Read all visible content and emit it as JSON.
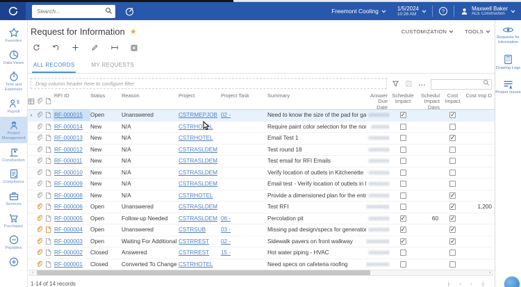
{
  "top_bar": {
    "search_placeholder": "Search...",
    "company": "Freemont Cooling",
    "date": "1/5/2024",
    "time": "10:26 AM",
    "user_name": "Maxwell Baker",
    "user_org": "ACE Construction"
  },
  "sidebar": {
    "items": [
      {
        "label": "Favorites",
        "icon": "star",
        "selected": false
      },
      {
        "label": "Data Views",
        "icon": "pie",
        "selected": false
      },
      {
        "label": "Time and Expenses",
        "icon": "stopwatch",
        "selected": false
      },
      {
        "label": "Payroll",
        "icon": "payroll",
        "selected": false
      },
      {
        "label": "Project Management",
        "icon": "worker",
        "selected": true
      },
      {
        "label": "Construction",
        "icon": "crane",
        "selected": false
      },
      {
        "label": "Compliance",
        "icon": "clipboard",
        "selected": false
      },
      {
        "label": "Services",
        "icon": "briefcase",
        "selected": false
      },
      {
        "label": "Purchases",
        "icon": "cart",
        "selected": false
      },
      {
        "label": "Payables",
        "icon": "minus-circle",
        "selected": false
      },
      {
        "label": "",
        "icon": "plus-circle",
        "selected": false
      }
    ]
  },
  "page": {
    "title": "Request for Information",
    "menus": [
      {
        "label": "CUSTOMIZATION"
      },
      {
        "label": "TOOLS"
      }
    ],
    "tabs": [
      {
        "label": "ALL RECORDS",
        "active": true
      },
      {
        "label": "MY REQUESTS",
        "active": false
      }
    ],
    "filter_hint": "Drag column header here to configure filter"
  },
  "right_panel": {
    "items": [
      {
        "label": "Requests for Information",
        "icon": "eye"
      },
      {
        "label": "Drawing Logs",
        "icon": "calculator"
      },
      {
        "label": "Project Issues",
        "icon": "issues"
      }
    ]
  },
  "grid": {
    "columns": {
      "id": "RFI ID",
      "status": "Status",
      "reason": "Reason",
      "project": "Project",
      "task": "Project Task",
      "summary": "Summary",
      "due": "Answer Due Date",
      "sched": "Schedule Impact",
      "days": "Schedul Impact Days",
      "cost": "Cost Impact",
      "costimp": "Cost Imp D"
    },
    "rows": [
      {
        "id": "RF-000015",
        "status": "Open",
        "reason": "Unanswered",
        "project": "CSTRMEPJOB",
        "task": "02 -",
        "summary": "Need to know the size of the pad for garba...",
        "due_blur": "0/00/0000",
        "sched": true,
        "days": "",
        "cost": true,
        "costimp": "",
        "clip": "gray",
        "note": "gray",
        "selected": true
      },
      {
        "id": "RF-000014",
        "status": "New",
        "reason": "N/A",
        "project": "CSTRHOTEL",
        "task": "",
        "summary": "Require paint color selection for the north ...",
        "due_blur": "0/0/0000",
        "sched": false,
        "days": "",
        "cost": false,
        "costimp": "",
        "clip": "gray",
        "note": "gray",
        "selected": false
      },
      {
        "id": "RF-000013",
        "status": "New",
        "reason": "N/A",
        "project": "CSTRHOTEL",
        "task": "",
        "summary": "Email Test 1",
        "due_blur": "0/00/0000",
        "sched": false,
        "days": "",
        "cost": true,
        "costimp": "",
        "clip": "gray",
        "note": "gray",
        "selected": false
      },
      {
        "id": "RF-000012",
        "status": "New",
        "reason": "N/A",
        "project": "CSTRASLDEM",
        "task": "",
        "summary": "Test round 18",
        "due_blur": "0/00/0000",
        "sched": false,
        "days": "",
        "cost": false,
        "costimp": "",
        "clip": "gray",
        "note": "gray",
        "selected": false
      },
      {
        "id": "RF-000011",
        "status": "New",
        "reason": "N/A",
        "project": "CSTRASLDEM",
        "task": "",
        "summary": "Test email for RFI Emails",
        "due_blur": "0/00/0000",
        "sched": false,
        "days": "",
        "cost": false,
        "costimp": "",
        "clip": "gray",
        "note": "gray",
        "selected": false
      },
      {
        "id": "RF-000010",
        "status": "New",
        "reason": "N/A",
        "project": "CSTRASLDEM",
        "task": "",
        "summary": "Verify location of outlets in Kitchenette",
        "due_blur": "0/00/0000",
        "sched": false,
        "days": "",
        "cost": false,
        "costimp": "",
        "clip": "gray",
        "note": "gray",
        "selected": false
      },
      {
        "id": "RF-000009",
        "status": "New",
        "reason": "N/A",
        "project": "CSTRASLDEM",
        "task": "",
        "summary": "Email test - Verify location of outlets in Kitc...",
        "due_blur": "0/00/0000",
        "sched": false,
        "days": "",
        "cost": false,
        "costimp": "",
        "clip": "gray",
        "note": "gray",
        "selected": false
      },
      {
        "id": "RF-000008",
        "status": "New",
        "reason": "N/A",
        "project": "CSTRHOTEL",
        "task": "",
        "summary": "Provide a dimensioned plan for the entryway",
        "due_blur": "0/00/0000",
        "sched": false,
        "days": "",
        "cost": true,
        "costimp": "",
        "clip": "gray",
        "note": "gray",
        "selected": false
      },
      {
        "id": "RF-000006",
        "status": "Open",
        "reason": "Unanswered",
        "project": "CSTRASLDEM",
        "task": "",
        "summary": "Test RFI",
        "due_blur": "00/00/0000",
        "sched": false,
        "days": "",
        "cost": true,
        "costimp": "1,200",
        "clip": "orange",
        "note": "gray",
        "selected": false
      },
      {
        "id": "RF-000005",
        "status": "Open",
        "reason": "Follow-up Needed",
        "project": "CSTRASLDEM",
        "task": "06 -",
        "summary": "Percolation pit",
        "due_blur": "0/00/0000",
        "sched": true,
        "days": "60",
        "cost": true,
        "costimp": "",
        "clip": "orange",
        "note": "gray",
        "selected": false
      },
      {
        "id": "RF-000004",
        "status": "Open",
        "reason": "Unanswered",
        "project": "CSTRSUB",
        "task": "03 -",
        "summary": "Missing pad design/specs for generator",
        "due_blur": "00/0/0000",
        "sched": true,
        "days": "",
        "cost": true,
        "costimp": "",
        "clip": "orange",
        "note": "orange",
        "selected": false
      },
      {
        "id": "RF-000003",
        "status": "Open",
        "reason": "Waiting For Additional Info",
        "project": "CSTRREST",
        "task": "02 -",
        "summary": "Sidewalk pavers on front walkway",
        "due_blur": "00/00/0000",
        "sched": true,
        "days": "",
        "cost": true,
        "costimp": "",
        "clip": "orange",
        "note": "gray",
        "selected": false
      },
      {
        "id": "RF-000002",
        "status": "Closed",
        "reason": "Answered",
        "project": "CSTRREST",
        "task": "15 -",
        "summary": "Hot water piping - HVAC",
        "due_blur": "0/00/0000",
        "sched": false,
        "days": "",
        "cost": false,
        "costimp": "",
        "clip": "orange",
        "note": "gray",
        "selected": false
      },
      {
        "id": "RF-000001",
        "status": "Closed",
        "reason": "Converted To Change Re...",
        "project": "CSTRHOTEL",
        "task": "",
        "summary": "Need specs on cafeteria roofing",
        "due_blur": "00/00/0000",
        "sched": false,
        "days": "",
        "cost": false,
        "costimp": "",
        "clip": "orange",
        "note": "gray",
        "selected": false
      }
    ],
    "footer": "1-14 of 14 records"
  },
  "colors": {
    "topbar": "#2858ab",
    "logo_tile": "#1c418f",
    "link": "#4f81c4",
    "tab_active": "#3f87c9",
    "favorite_star": "#f2a33c",
    "attachment_amber": "#c8861d",
    "selected_row": "#e7f2fd",
    "sidebar_selected": "#cfe0f4"
  }
}
